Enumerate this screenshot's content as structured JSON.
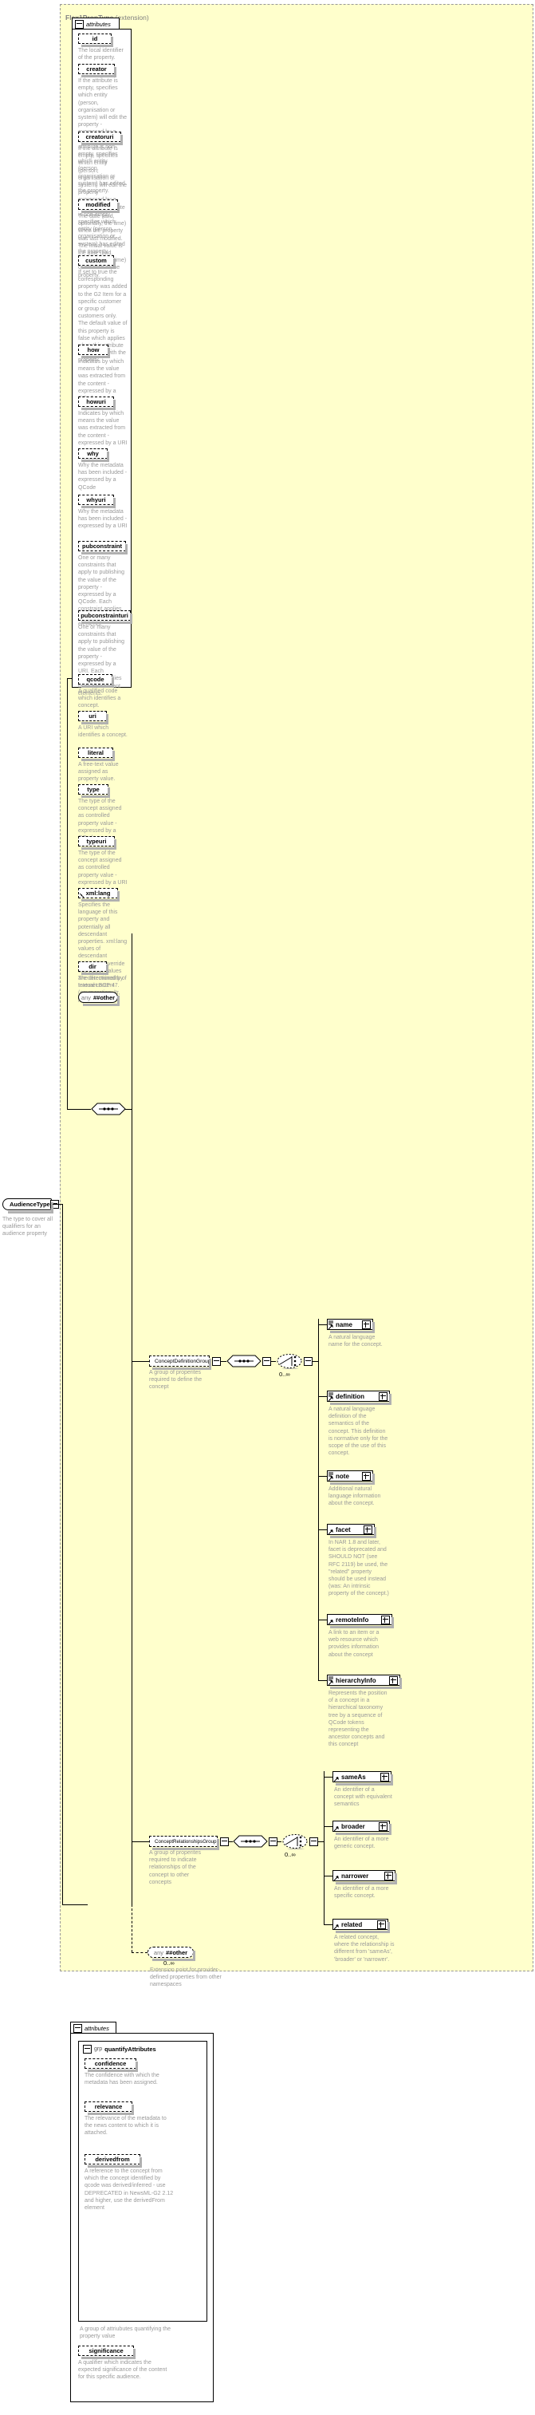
{
  "root": {
    "name": "AudienceType",
    "desc": "The type to cover all qualifiers for an audience property"
  },
  "type_panel": {
    "title": "Flex1PropType",
    "title_suffix": " (extension)",
    "attributes_label": "attributes"
  },
  "attributes": [
    {
      "name": "id",
      "desc": "The local identifier of the property."
    },
    {
      "name": "creator",
      "desc": "If the attribute is empty, specifies which entity (person, organisation or system) will edit the property - expressed by a QCode. If the attribute is non-empty, specifies which entity (person, organisation or system) has edited the property."
    },
    {
      "name": "creatoruri",
      "desc": "If the attribute is empty, specifies which entity (person, organisation or system) will edit the property - expressed by a URI. If the attribute is non-empty, specifies which entity (person, organisation or system) has edited the property."
    },
    {
      "name": "modified",
      "desc": "The date (and, optionally, the time) when the property was last modified. The initial value is the date (and, optionally, the time) of creation of the property."
    },
    {
      "name": "custom",
      "desc": "If set to true the corresponding property was added to the G2 Item for a specific customer or group of customers only. The default value of this property is false which applies when this attribute is not used with the property."
    },
    {
      "name": "how",
      "desc": "Indicates by which means the value was extracted from the content - expressed by a QCode"
    },
    {
      "name": "howuri",
      "desc": "Indicates by which means the value was extracted from the content - expressed by a URI"
    },
    {
      "name": "why",
      "desc": "Why the metadata has been included - expressed by a QCode"
    },
    {
      "name": "whyuri",
      "desc": "Why the metadata has been included - expressed by a URI"
    },
    {
      "name": "pubconstraint",
      "desc": "One or many constraints that apply to publishing the value of the property - expressed by a QCode. Each constraint applies to all descendant elements."
    },
    {
      "name": "pubconstrainturi",
      "desc": "One or many constraints that apply to publishing the value of the property - expressed by a URI. Each constraint applies to all descendant elements."
    },
    {
      "name": "qcode",
      "desc": "A qualified code which identifies a concept."
    },
    {
      "name": "uri",
      "desc": "A URI which identifies a concept."
    },
    {
      "name": "literal",
      "desc": "A free-text value assigned as property value."
    },
    {
      "name": "type",
      "desc": "The type of the concept assigned as controlled property value - expressed by a QCode"
    },
    {
      "name": "typeuri",
      "desc": "The type of the concept assigned as controlled property value - expressed by a URI"
    },
    {
      "name": "xml:lang",
      "desc": "Specifies the language of this property and potentially all descendant properties. xml:lang values of descendant properties override this value. Values are determined by Internet BCP 47.",
      "link": true
    },
    {
      "name": "dir",
      "desc": "The directionality of textual content (enumeration: ltr, rtl)"
    }
  ],
  "attr_any": {
    "prefix": "any",
    "name": "##other"
  },
  "groups": [
    {
      "id": "definition-group",
      "name": "ConceptDefinitionGroup",
      "desc": "A group of properites required to define the concept",
      "cardinality": "0..∞",
      "children": [
        {
          "name": "name",
          "desc": "A natural language name for the concept."
        },
        {
          "name": "definition",
          "desc": "A natural language definition of the semantics of the concept. This definition is normative only for the scope of the use of this concept."
        },
        {
          "name": "note",
          "desc": "Additional natural language information about the concept."
        },
        {
          "name": "facet",
          "desc": "In NAR 1.8 and later, facet is deprecated and SHOULD NOT (see RFC 2119) be used, the \"related\" property should be used instead (was: An intrinsic property of the concept.)"
        },
        {
          "name": "remoteInfo",
          "desc": "A link to an item or a web resource which provides information about the concept"
        },
        {
          "name": "hierarchyInfo",
          "desc": "Represents the position of a concept in a hierarchical taxonomy tree by a sequence of QCode tokens representing the ancestor concepts and this concept"
        }
      ]
    },
    {
      "id": "relationships-group",
      "name": "ConceptRelationshipsGroup",
      "desc": "A group of properites required to indicate relationships of the concept to other concepts",
      "cardinality": "0..∞",
      "children": [
        {
          "name": "sameAs",
          "desc": "An identifier of a concept with equivalent semantics"
        },
        {
          "name": "broader",
          "desc": "An identifier of a more generic concept."
        },
        {
          "name": "narrower",
          "desc": "An identifier of a more specific concept."
        },
        {
          "name": "related",
          "desc": "A related concept, where the relationship is different from 'sameAs', 'broader' or 'narrower'."
        }
      ]
    }
  ],
  "element_any": {
    "prefix": "any",
    "name": "##other",
    "cardinality": "0..∞",
    "desc": "Extension point for provider-defined properties from other namespaces"
  },
  "bottom": {
    "attributes_label": "attributes",
    "group_prefix": "grp",
    "group_name": "quantifyAttributes",
    "group_desc": "A group of attriubutes quantifying the property value",
    "items": [
      {
        "name": "confidence",
        "desc": "The confidence with which the metadata has been assigned."
      },
      {
        "name": "relevance",
        "desc": "The relevance of the metadata to the news content to which it is attached."
      },
      {
        "name": "derivedfrom",
        "desc": "A reference to the concept from which the concept identified by qcode was derived/inferred - use DEPRECATED in NewsML-G2 2.12 and higher, use the derivedFrom element"
      }
    ],
    "extra": [
      {
        "name": "significance",
        "desc": "A qualifier which indicates the expected significance of the content for this specific audience."
      }
    ]
  },
  "colors": {
    "panel_bg": "#ffffcc",
    "panel_border": "#999999",
    "desc_text": "#9a9a9a",
    "shadow": "#b0b0b0",
    "line": "#000000"
  }
}
